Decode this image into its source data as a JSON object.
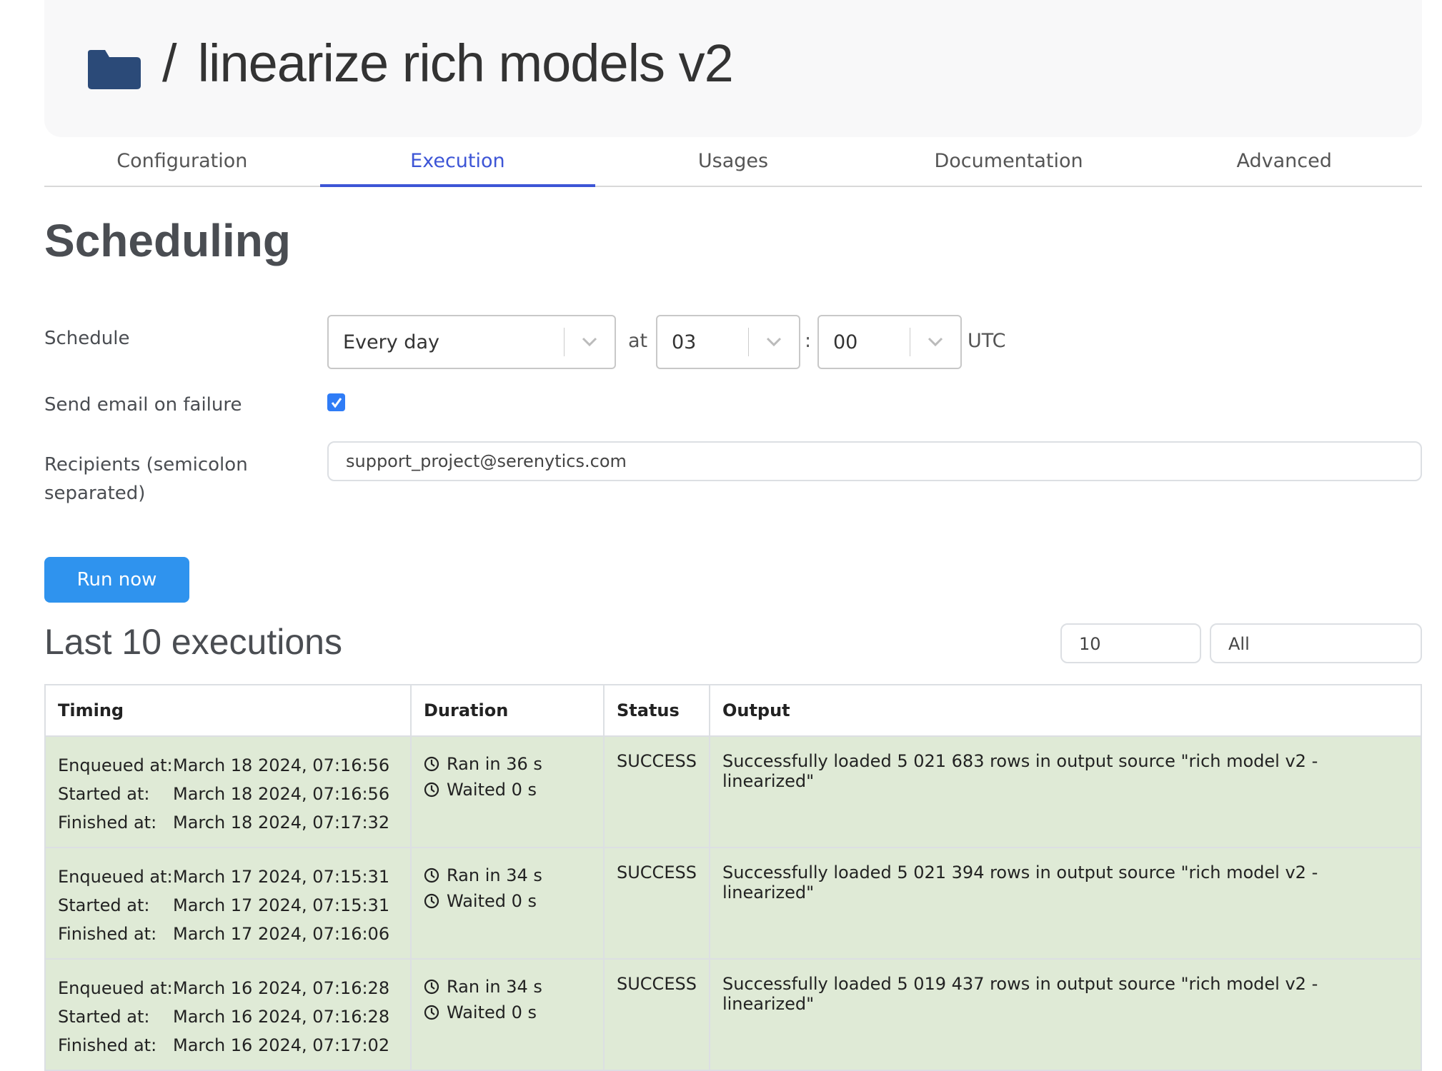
{
  "header": {
    "folder_icon": "folder-icon",
    "separator": "/",
    "title": "linearize rich models v2",
    "folder_color": "#2b4a78"
  },
  "tabs": [
    {
      "label": "Configuration",
      "active": false
    },
    {
      "label": "Execution",
      "active": true
    },
    {
      "label": "Usages",
      "active": false
    },
    {
      "label": "Documentation",
      "active": false
    },
    {
      "label": "Advanced",
      "active": false
    }
  ],
  "scheduling": {
    "title": "Scheduling",
    "schedule_label": "Schedule",
    "frequency": "Every day",
    "at_label": "at",
    "hour": "03",
    "colon": ":",
    "minute": "00",
    "timezone": "UTC",
    "email_label": "Send email on failure",
    "email_checked": true,
    "recipients_label_line1": "Recipients (semicolon",
    "recipients_label_line2": "separated)",
    "recipients_value": "support_project@serenytics.com",
    "run_now_label": "Run now"
  },
  "executions": {
    "title": "Last 10 executions",
    "count_value": "10",
    "filter_value": "All",
    "columns": [
      "Timing",
      "Duration",
      "Status",
      "Output"
    ],
    "rows": [
      {
        "enqueued_label": "Enqueued at:",
        "enqueued": "March 18 2024, 07:16:56",
        "started_label": "Started at:",
        "started": "March 18 2024, 07:16:56",
        "finished_label": "Finished at:",
        "finished": "March 18 2024, 07:17:32",
        "ran": "Ran in 36 s",
        "waited": "Waited 0 s",
        "status": "SUCCESS",
        "output": "Successfully loaded 5 021 683 rows in output source \"rich model v2 - linearized\""
      },
      {
        "enqueued_label": "Enqueued at:",
        "enqueued": "March 17 2024, 07:15:31",
        "started_label": "Started at:",
        "started": "March 17 2024, 07:15:31",
        "finished_label": "Finished at:",
        "finished": "March 17 2024, 07:16:06",
        "ran": "Ran in 34 s",
        "waited": "Waited 0 s",
        "status": "SUCCESS",
        "output": "Successfully loaded 5 021 394 rows in output source \"rich model v2 - linearized\""
      },
      {
        "enqueued_label": "Enqueued at:",
        "enqueued": "March 16 2024, 07:16:28",
        "started_label": "Started at:",
        "started": "March 16 2024, 07:16:28",
        "finished_label": "Finished at:",
        "finished": "March 16 2024, 07:17:02",
        "ran": "Ran in 34 s",
        "waited": "Waited 0 s",
        "status": "SUCCESS",
        "output": "Successfully loaded 5 019 437 rows in output source \"rich model v2 - linearized\""
      }
    ],
    "success_row_color": "#dfead6"
  },
  "colors": {
    "accent": "#3d55d6",
    "button": "#2f93ee",
    "checkbox": "#2f7cf6"
  }
}
